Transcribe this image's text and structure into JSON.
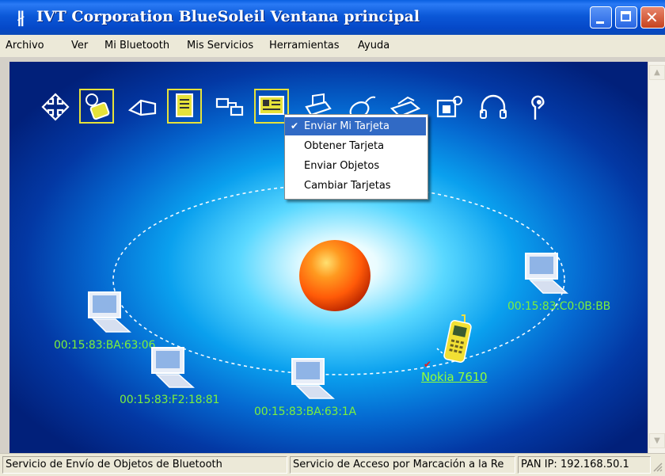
{
  "window": {
    "title": "IVT Corporation BlueSoleil Ventana principal",
    "icon": "bluetooth-icon",
    "controls": [
      "minimize",
      "maximize",
      "close"
    ]
  },
  "menu": [
    "Archivo",
    "Ver",
    "Mi Bluetooth",
    "Mis Servicios",
    "Herramientas",
    "Ayuda"
  ],
  "toolbar_icons": [
    {
      "name": "network-access-icon",
      "selected": false
    },
    {
      "name": "dialup-networking-icon",
      "selected": true
    },
    {
      "name": "file-transfer-icon",
      "selected": false
    },
    {
      "name": "sync-icon",
      "selected": true
    },
    {
      "name": "serial-port-icon",
      "selected": false
    },
    {
      "name": "object-push-icon",
      "selected": true
    },
    {
      "name": "printer-icon",
      "selected": false
    },
    {
      "name": "mouse-icon",
      "selected": false
    },
    {
      "name": "fax-icon",
      "selected": false
    },
    {
      "name": "imaging-icon",
      "selected": false
    },
    {
      "name": "headset-icon",
      "selected": false
    },
    {
      "name": "audio-gateway-icon",
      "selected": false
    }
  ],
  "context_menu": {
    "items": [
      {
        "label": "Enviar Mi Tarjeta",
        "checked": true,
        "highlighted": true
      },
      {
        "label": "Obtener Tarjeta",
        "checked": false,
        "highlighted": false
      },
      {
        "label": "Enviar Objetos",
        "checked": false,
        "highlighted": false
      },
      {
        "label": "Cambiar Tarjetas",
        "checked": false,
        "highlighted": false
      }
    ]
  },
  "devices": [
    {
      "label": "00:15:83:C0:0B:BB",
      "type": "computer"
    },
    {
      "label": "00:15:83:BA:63:06",
      "type": "computer"
    },
    {
      "label": "00:15:83:F2:18:81",
      "type": "computer"
    },
    {
      "label": "00:15:83:BA:63:1A",
      "type": "computer"
    },
    {
      "label": "Nokia 7610",
      "type": "phone",
      "paired": true
    }
  ],
  "status": {
    "pane1": "Servicio de Envío de Objetos de Bluetooth",
    "pane2": "Servicio de Acceso por Marcación a la Re",
    "pane3": "PAN IP: 192.168.50.1"
  },
  "colors": {
    "title_bar": "#0a58d8",
    "device_label": "#7cf03c",
    "menu_highlight": "#316ac5",
    "icon_selected_border": "#e6e23a",
    "orb": "#ff6a10"
  }
}
